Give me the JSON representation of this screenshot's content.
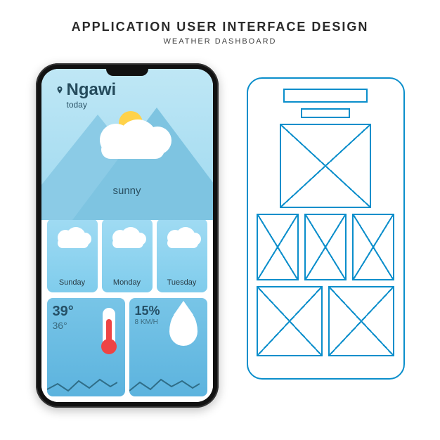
{
  "header": {
    "title": "APPLICATION USER INTERFACE DESIGN",
    "subtitle": "WEATHER DASHBOARD"
  },
  "weather": {
    "location": "Ngawi",
    "day_label": "today",
    "condition": "sunny",
    "forecast": [
      {
        "day": "Sunday",
        "icon": "cloud"
      },
      {
        "day": "Monday",
        "icon": "partly-sunny"
      },
      {
        "day": "Tuesday",
        "icon": "cloud"
      }
    ],
    "temp_high": "39°",
    "temp_low": "36°",
    "humidity": "15%",
    "wind": "8 KM/H"
  },
  "colors": {
    "wireframe": "#0a8ecb",
    "sky": "#a0dbf3"
  }
}
